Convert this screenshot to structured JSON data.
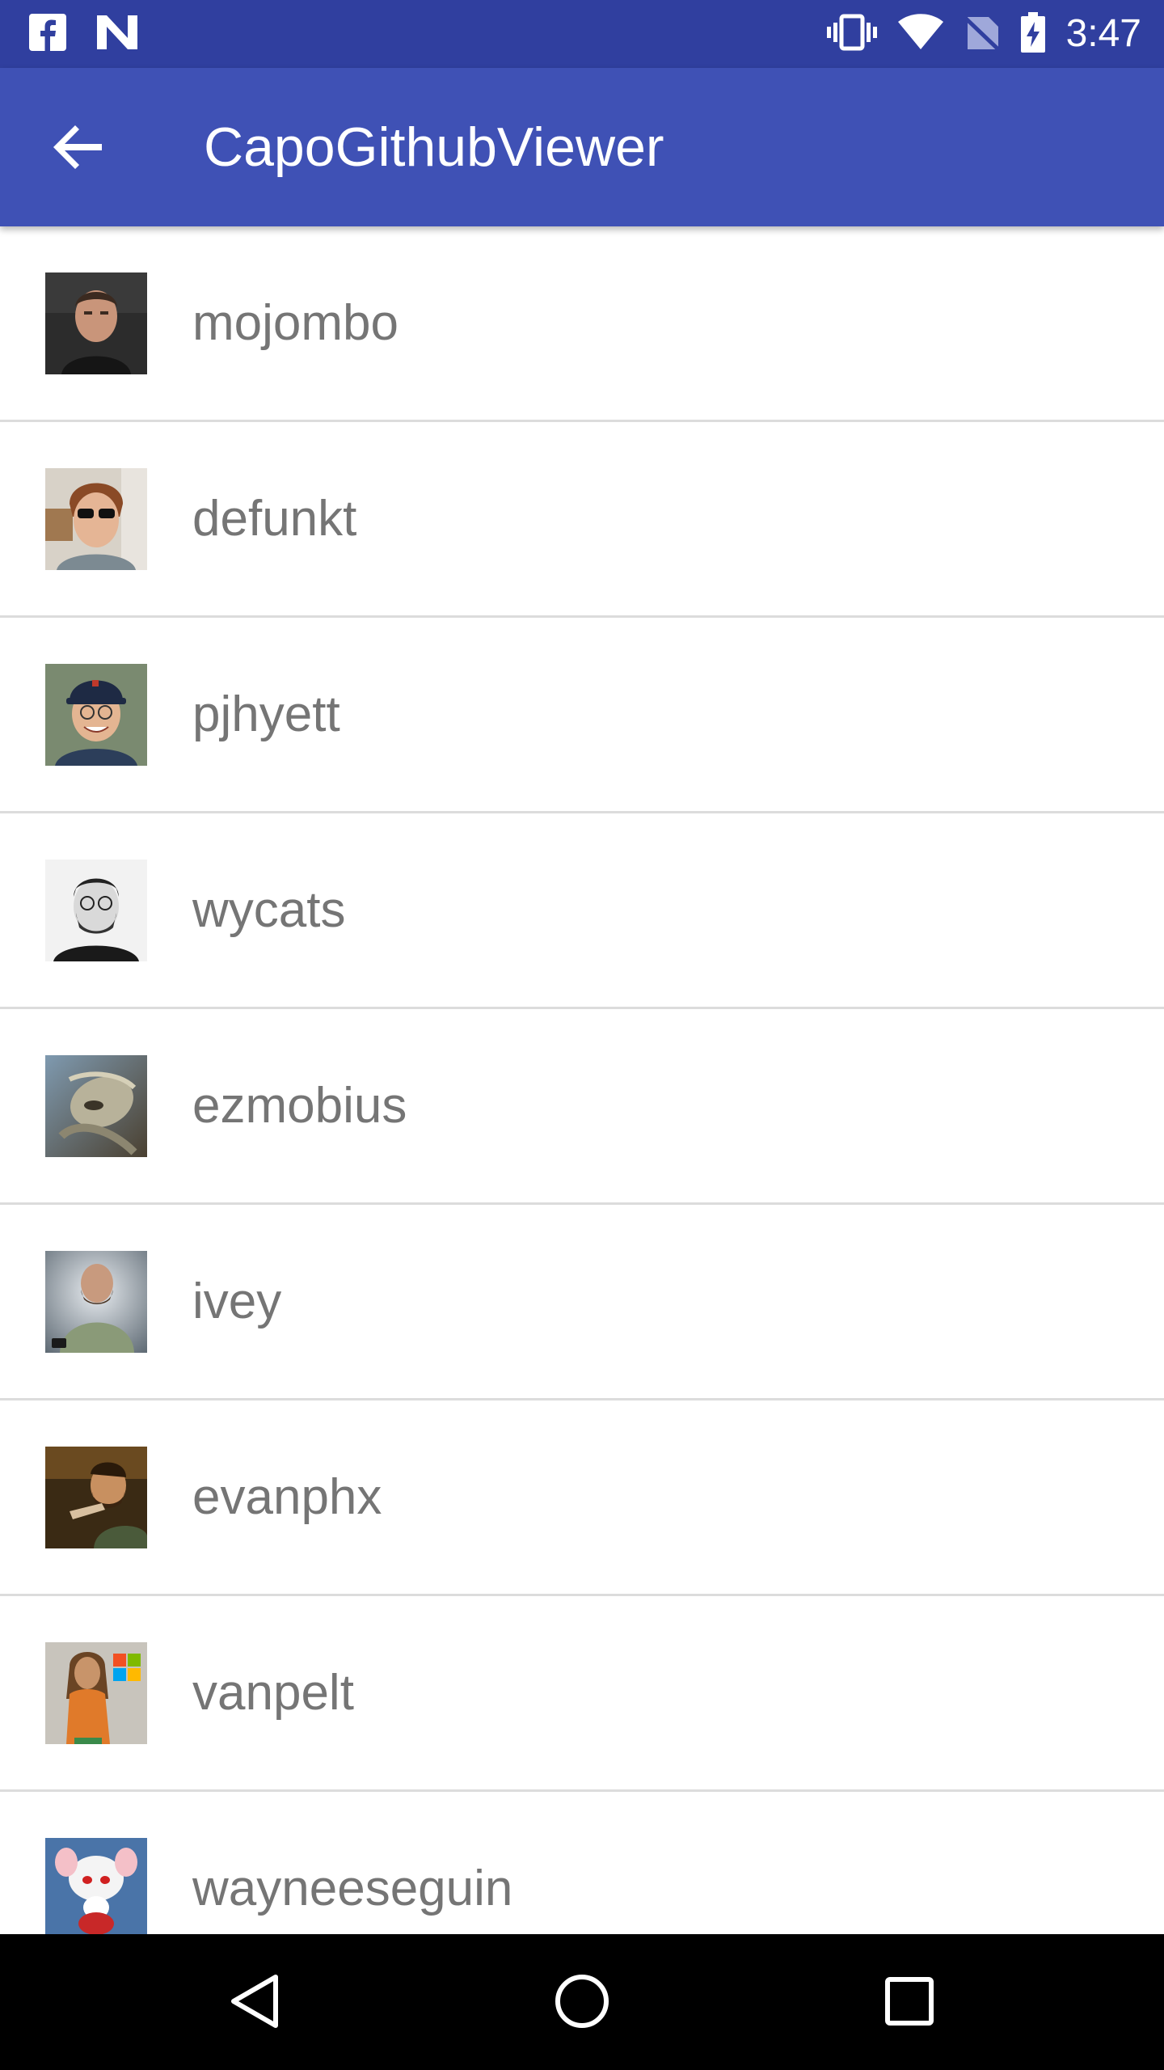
{
  "status_bar": {
    "time": "3:47",
    "icons": [
      "facebook-notification-icon",
      "n-notification-icon",
      "vibrate-icon",
      "wifi-icon",
      "no-sim-icon",
      "battery-charging-icon"
    ]
  },
  "app_bar": {
    "back_icon": "arrow-back-icon",
    "title": "CapoGithubViewer",
    "colors": {
      "primary": "#3f51b5",
      "primary_dark": "#303f9f"
    }
  },
  "users": [
    {
      "username": "mojombo",
      "avatar": "avatar-mojombo"
    },
    {
      "username": "defunkt",
      "avatar": "avatar-defunkt"
    },
    {
      "username": "pjhyett",
      "avatar": "avatar-pjhyett"
    },
    {
      "username": "wycats",
      "avatar": "avatar-wycats"
    },
    {
      "username": "ezmobius",
      "avatar": "avatar-ezmobius"
    },
    {
      "username": "ivey",
      "avatar": "avatar-ivey"
    },
    {
      "username": "evanphx",
      "avatar": "avatar-evanphx"
    },
    {
      "username": "vanpelt",
      "avatar": "avatar-vanpelt"
    },
    {
      "username": "wayneeseguin",
      "avatar": "avatar-wayneeseguin"
    }
  ],
  "nav_bar": {
    "buttons": [
      "back-triangle-icon",
      "home-circle-icon",
      "recents-square-icon"
    ]
  }
}
